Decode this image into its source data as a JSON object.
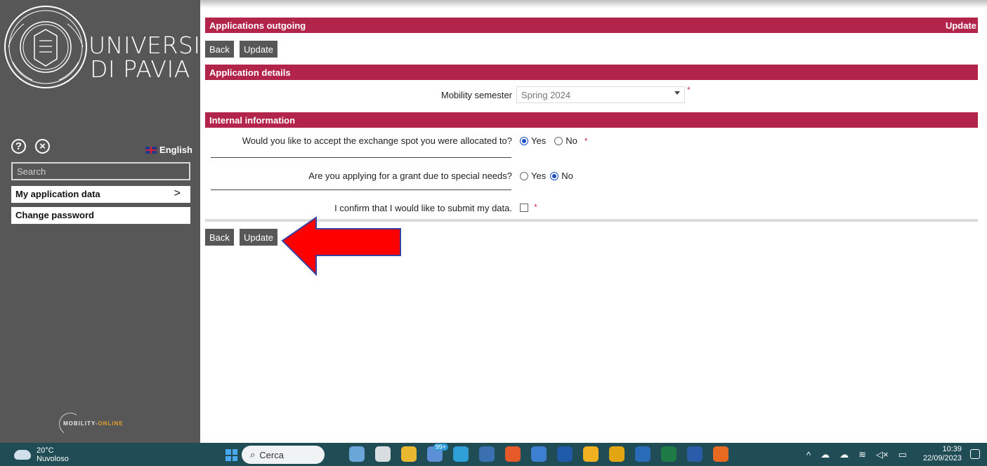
{
  "sidebar": {
    "logo_line1": "UNIVERSITÀ",
    "logo_line2": "DI PAVIA",
    "language": "English",
    "search_placeholder": "Search",
    "menu": [
      {
        "label": "My application data"
      },
      {
        "label": "Change password"
      }
    ],
    "chevron": ">",
    "footer_brand_a": "MOBILITY-",
    "footer_brand_b": "ONLINE"
  },
  "main": {
    "header_title": "Applications outgoing",
    "header_action": "Update",
    "back_label": "Back",
    "update_label": "Update",
    "section_details": "Application details",
    "mobility_semester_label": "Mobility semester",
    "mobility_semester_value": "Spring 2024",
    "section_internal": "Internal information",
    "q_accept": "Would you like to accept the exchange spot you were allocated to?",
    "q_accept_selected": "Yes",
    "q_grant": "Are you applying for a grant due to special needs?",
    "q_grant_selected": "No",
    "opt_yes": "Yes",
    "opt_no": "No",
    "q_confirm": "I confirm that I would like to submit my data.",
    "required_mark": "*",
    "arrow_color": "#ff0000"
  },
  "colors": {
    "accent": "#b2244a",
    "sidebar": "#575757",
    "taskbar": "#1f4c55"
  },
  "taskbar": {
    "temperature": "20°C",
    "condition": "Nuvoloso",
    "search_label": "Cerca",
    "badge": "99+",
    "time": "10:39",
    "date": "22/09/2023"
  }
}
